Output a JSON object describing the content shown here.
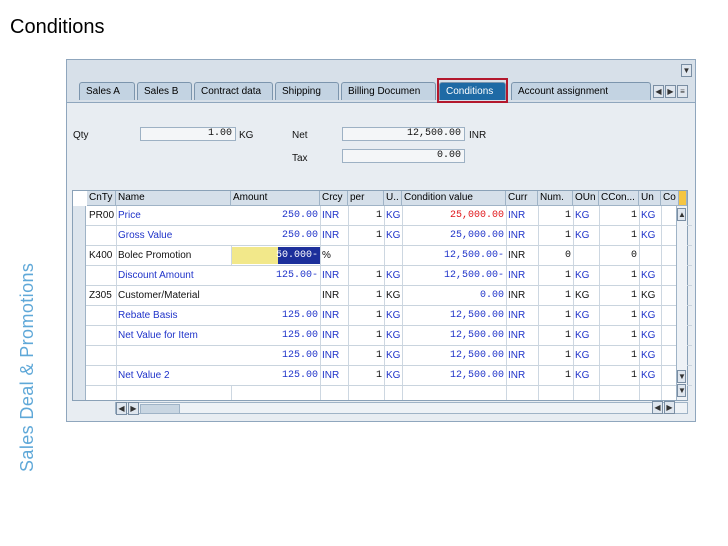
{
  "slide": {
    "title": "Conditions",
    "side_label": "Sales Deal & Promotions"
  },
  "tabs": [
    {
      "label": "Sales A",
      "active": false
    },
    {
      "label": "Sales B",
      "active": false
    },
    {
      "label": "Contract data",
      "active": false
    },
    {
      "label": "Shipping",
      "active": false
    },
    {
      "label": "Billing Documen",
      "active": false
    },
    {
      "label": "Conditions",
      "active": true
    },
    {
      "label": "Account assignment",
      "active": false
    }
  ],
  "header": {
    "qty_label": "Qty",
    "qty_value": "1.00",
    "qty_unit": "KG",
    "net_label": "Net",
    "net_value": "12,500.00",
    "net_currency": "INR",
    "tax_label": "Tax",
    "tax_value": "0.00"
  },
  "grid": {
    "columns": [
      "CnTy",
      "Name",
      "Amount",
      "Crcy",
      "per",
      "U..",
      "Condition value",
      "Curr",
      "Num.",
      "OUn",
      "CCon...",
      "Un",
      "Co"
    ],
    "rows": [
      {
        "cnty": "PR00",
        "name": "Price",
        "amount": "250.00",
        "crcy": "INR",
        "per": "1",
        "uom": "KG",
        "cond_value": "25,000.00",
        "curr": "INR",
        "num": "1",
        "oun": "KG",
        "ccon": "1",
        "un": "KG",
        "style": "red"
      },
      {
        "cnty": "",
        "name": "Gross Value",
        "amount": "250.00",
        "crcy": "INR",
        "per": "1",
        "uom": "KG",
        "cond_value": "25,000.00",
        "curr": "INR",
        "num": "1",
        "oun": "KG",
        "ccon": "1",
        "un": "KG",
        "style": "blue"
      },
      {
        "cnty": "K400",
        "name": "Bolec Promotion",
        "amount": "50.000-",
        "crcy": "%",
        "per": "",
        "uom": "",
        "cond_value": "12,500.00-",
        "curr": "INR",
        "num": "0",
        "oun": "",
        "ccon": "0",
        "un": "",
        "style": "black"
      },
      {
        "cnty": "",
        "name": "Discount Amount",
        "amount": "125.00-",
        "crcy": "INR",
        "per": "1",
        "uom": "KG",
        "cond_value": "12,500.00-",
        "curr": "INR",
        "num": "1",
        "oun": "KG",
        "ccon": "1",
        "un": "KG",
        "style": "blue"
      },
      {
        "cnty": "Z305",
        "name": "Customer/Material",
        "amount": "",
        "crcy": "INR",
        "per": "1",
        "uom": "KG",
        "cond_value": "0.00",
        "curr": "INR",
        "num": "1",
        "oun": "KG",
        "ccon": "1",
        "un": "KG",
        "style": "black"
      },
      {
        "cnty": "",
        "name": "Rebate Basis",
        "amount": "125.00",
        "crcy": "INR",
        "per": "1",
        "uom": "KG",
        "cond_value": "12,500.00",
        "curr": "INR",
        "num": "1",
        "oun": "KG",
        "ccon": "1",
        "un": "KG",
        "style": "blue"
      },
      {
        "cnty": "",
        "name": "Net Value for Item",
        "amount": "125.00",
        "crcy": "INR",
        "per": "1",
        "uom": "KG",
        "cond_value": "12,500.00",
        "curr": "INR",
        "num": "1",
        "oun": "KG",
        "ccon": "1",
        "un": "KG",
        "style": "blue"
      },
      {
        "cnty": "",
        "name": "",
        "amount": "125.00",
        "crcy": "INR",
        "per": "1",
        "uom": "KG",
        "cond_value": "12,500.00",
        "curr": "INR",
        "num": "1",
        "oun": "KG",
        "ccon": "1",
        "un": "KG",
        "style": "blue"
      },
      {
        "cnty": "",
        "name": "Net Value 2",
        "amount": "125.00",
        "crcy": "INR",
        "per": "1",
        "uom": "KG",
        "cond_value": "12,500.00",
        "curr": "INR",
        "num": "1",
        "oun": "KG",
        "ccon": "1",
        "un": "KG",
        "style": "blue"
      }
    ]
  },
  "icons": {
    "scroll_left": "◀",
    "scroll_right": "▶",
    "scroll_up": "▲",
    "scroll_down": "▼",
    "dropdown": "▼",
    "first": "|◀",
    "last": "▶|"
  },
  "colors": {
    "active_tab": "#1e6aa5",
    "highlight_frame": "#b3182d",
    "value_red": "#e0161a",
    "value_blue": "#1f33c9",
    "side_label": "#5fa8d8"
  }
}
